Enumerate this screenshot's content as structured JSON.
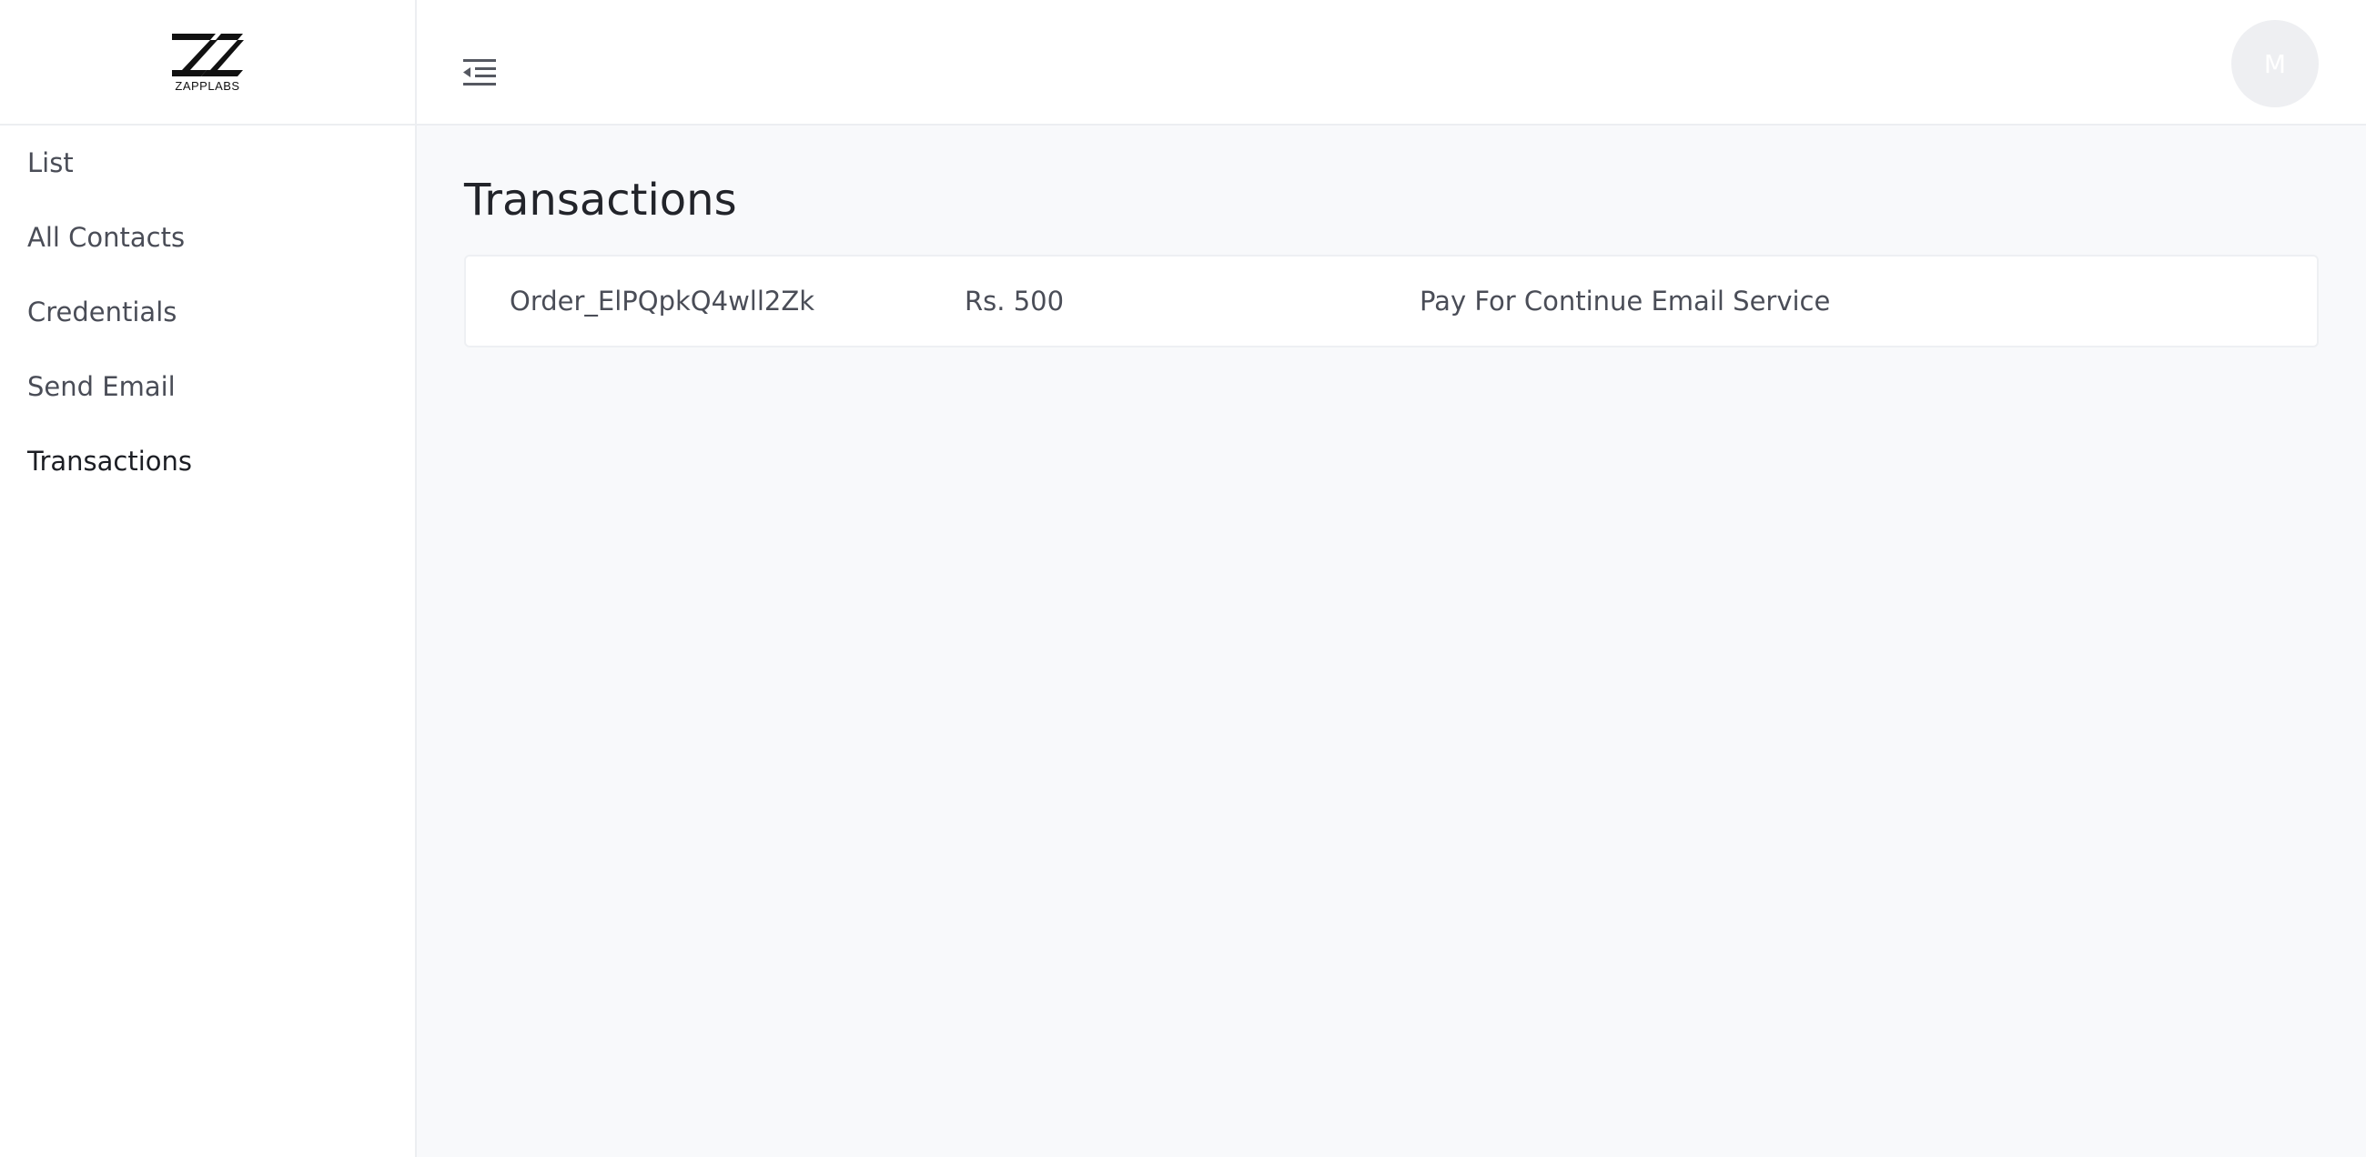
{
  "brand": {
    "name": "ZAPPLABS"
  },
  "sidebar": {
    "items": [
      {
        "label": "List"
      },
      {
        "label": "All Contacts"
      },
      {
        "label": "Credentials"
      },
      {
        "label": "Send Email"
      },
      {
        "label": "Transactions"
      }
    ],
    "active": "Transactions"
  },
  "header": {
    "menu_icon": "collapse-menu-icon",
    "avatar_initial": "M"
  },
  "main": {
    "title": "Transactions",
    "transactions": [
      {
        "order_id": "Order_ElPQpkQ4wll2Zk",
        "amount": "Rs. 500",
        "description": "Pay For Continue Email Service"
      }
    ]
  },
  "colors": {
    "sidebar_bg": "#ffffff",
    "page_bg": "#f8f9fb",
    "text_primary": "#22242a",
    "text_secondary": "#4a4d57",
    "border": "#eceef1"
  }
}
